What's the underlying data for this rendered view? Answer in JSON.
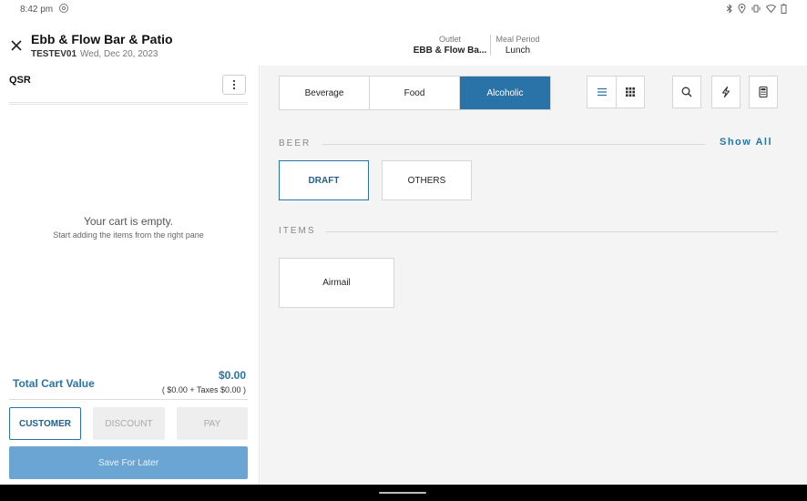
{
  "status_bar": {
    "time": "8:42 pm",
    "icons": [
      "bluetooth-icon",
      "location-icon",
      "vibrate-icon",
      "wifi-icon",
      "battery-icon"
    ]
  },
  "header": {
    "venue_name": "Ebb & Flow Bar & Patio",
    "terminal_code": "TESTEV01",
    "date": "Wed, Dec 20, 2023",
    "outlet_label": "Outlet",
    "outlet_value": "EBB & Flow Ba...",
    "meal_period_label": "Meal Period",
    "meal_period_value": "Lunch"
  },
  "cart": {
    "order_type": "QSR",
    "empty_title": "Your cart is empty.",
    "empty_subtitle": "Start adding the items from the right pane",
    "total_label": "Total Cart Value",
    "total_value": "$0.00",
    "total_breakdown": "( $0.00 + Taxes $0.00 )",
    "buttons": {
      "customer": "CUSTOMER",
      "discount": "DISCOUNT",
      "pay": "PAY",
      "save_for_later": "Save For Later"
    }
  },
  "menu": {
    "category_tabs": [
      {
        "label": "Beverage",
        "active": false
      },
      {
        "label": "Food",
        "active": false
      },
      {
        "label": "Alcoholic",
        "active": true
      }
    ],
    "toolbar_icons": [
      "list-view-icon",
      "grid-view-icon",
      "search-icon",
      "flash-icon",
      "calculator-icon"
    ],
    "beer_section": {
      "heading": "BEER",
      "show_all": "Show All",
      "subcategories": [
        "DRAFT",
        "OTHERS"
      ],
      "selected": "DRAFT"
    },
    "items_section": {
      "heading": "ITEMS",
      "items": [
        "Airmail"
      ]
    }
  },
  "colors": {
    "accent": "#2a73a8",
    "save_button": "#6aa5d3",
    "disabled_button": "#eeeeee",
    "right_pane_bg": "#f4f4f4"
  }
}
